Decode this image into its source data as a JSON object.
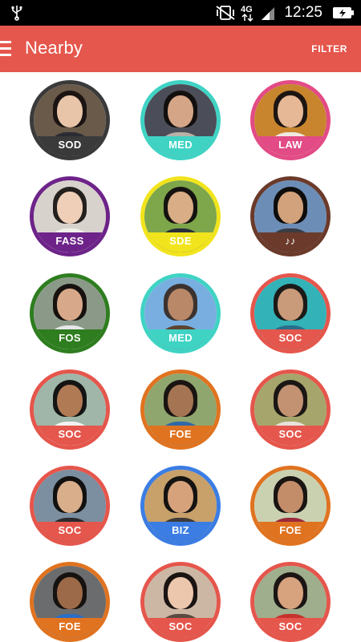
{
  "status_bar": {
    "icons": [
      "usb-icon",
      "vibrate-icon",
      "4g-icon",
      "signal-icon",
      "battery-charging-icon"
    ],
    "network": "4G",
    "time": "12:25"
  },
  "app_bar": {
    "title": "Nearby",
    "filter_label": "FILTER",
    "menu_icon": "hamburger-menu-icon",
    "color": "#e5564c"
  },
  "people": [
    {
      "label": "SOD",
      "ring": "#3a3a3a",
      "label_bg": "#3a3a3a"
    },
    {
      "label": "MED",
      "ring": "#3fd3c4",
      "label_bg": "#3fd3c4"
    },
    {
      "label": "LAW",
      "ring": "#e24b86",
      "label_bg": "#e24b86"
    },
    {
      "label": "FASS",
      "ring": "#6d2389",
      "label_bg": "#6d2389"
    },
    {
      "label": "SDE",
      "ring": "#f1e41c",
      "label_bg": "#f1e41c"
    },
    {
      "label": "♪♪",
      "ring": "#6b3a2a",
      "label_bg": "#6b3a2a"
    },
    {
      "label": "FOS",
      "ring": "#2e7d1f",
      "label_bg": "#2e7d1f"
    },
    {
      "label": "MED",
      "ring": "#3fd3c4",
      "label_bg": "#3fd3c4"
    },
    {
      "label": "SOC",
      "ring": "#e5564c",
      "label_bg": "#e5564c"
    },
    {
      "label": "SOC",
      "ring": "#e5564c",
      "label_bg": "#e5564c"
    },
    {
      "label": "FOE",
      "ring": "#e07320",
      "label_bg": "#e07320"
    },
    {
      "label": "SOC",
      "ring": "#e5564c",
      "label_bg": "#e5564c"
    },
    {
      "label": "SOC",
      "ring": "#e5564c",
      "label_bg": "#e5564c"
    },
    {
      "label": "BIZ",
      "ring": "#3b7de3",
      "label_bg": "#3b7de3"
    },
    {
      "label": "FOE",
      "ring": "#e07320",
      "label_bg": "#e07320"
    },
    {
      "label": "FOE",
      "ring": "#e07320",
      "label_bg": "#e07320"
    },
    {
      "label": "SOC",
      "ring": "#e5564c",
      "label_bg": "#e5564c"
    },
    {
      "label": "SOC",
      "ring": "#e5564c",
      "label_bg": "#e5564c"
    }
  ]
}
